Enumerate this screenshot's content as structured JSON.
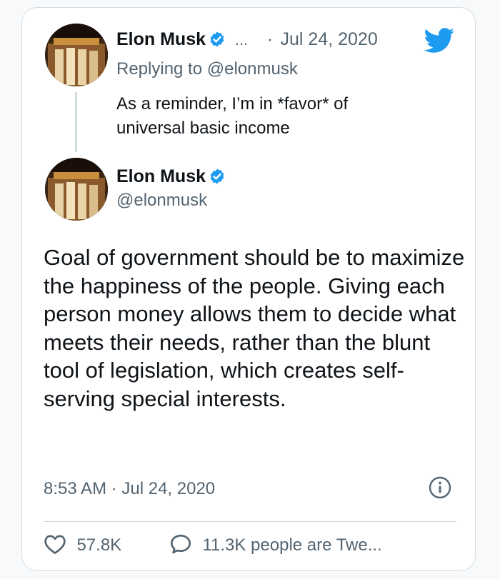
{
  "reply": {
    "author_name": "Elon Musk",
    "ellipsis": "...",
    "date_sep": "·",
    "date": "Jul 24, 2020",
    "replying_to": "Replying to @elonmusk",
    "text_line1": "As a reminder, I’m in *favor* of",
    "text_line2": "universal basic income"
  },
  "main": {
    "author_name": "Elon Musk",
    "handle": "@elonmusk",
    "body": "Goal of government should be to maximize the happiness of the people. Giving each person money allows them to decide what meets their needs, rather than the blunt tool of legislation, which creates self-serving special interests.",
    "timestamp": "8:53 AM · Jul 24, 2020"
  },
  "actions": {
    "likes": "57.8K",
    "retweet_people": "11.3K people are Twe..."
  },
  "icons": {
    "brand": "twitter-bird-icon",
    "verified": "verified-badge-icon",
    "info": "info-icon",
    "like": "heart-icon",
    "comment": "speech-bubble-icon"
  },
  "colors": {
    "accent": "#1d9bf0",
    "muted": "#536471",
    "text": "#0f1419"
  }
}
